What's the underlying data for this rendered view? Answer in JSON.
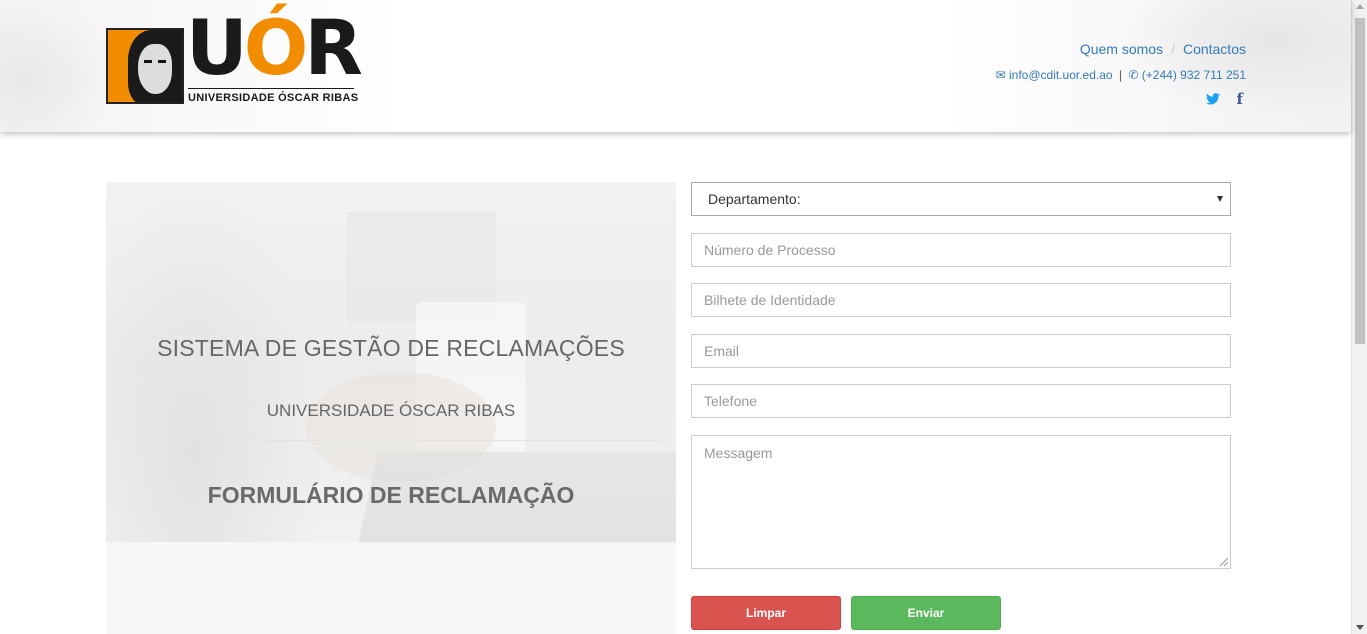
{
  "header": {
    "logo": {
      "text_dark_1": "U",
      "text_orange": "Ó",
      "text_dark_2": "R",
      "subtitle": "UNIVERSIDADE ÓSCAR RIBAS"
    },
    "nav": [
      {
        "label": "Quem somos"
      },
      {
        "label": "Contactos"
      }
    ],
    "nav_separator": "/",
    "contact": {
      "email": "info@cdit.uor.ed.ao",
      "separator": "|",
      "phone": "(+244) 932 711 251"
    },
    "social": {
      "twitter_glyph": "🐦",
      "facebook_glyph": "f"
    }
  },
  "hero": {
    "title": "SISTEMA DE GESTÃO DE RECLAMAÇÕES",
    "subtitle": "UNIVERSIDADE ÓSCAR RIBAS",
    "form_title": "FORMULÁRIO DE RECLAMAÇÃO"
  },
  "form": {
    "department_select": {
      "selected": "Departamento:"
    },
    "process_number": {
      "placeholder": "Número de Processo"
    },
    "identity_card": {
      "placeholder": "Bilhete de Identidade"
    },
    "email": {
      "placeholder": "Email"
    },
    "phone": {
      "placeholder": "Telefone"
    },
    "message": {
      "placeholder": "Messagem"
    },
    "buttons": {
      "clear": "Limpar",
      "send": "Enviar"
    }
  },
  "colors": {
    "brand_orange": "#f28c00",
    "link_blue": "#337ab7",
    "danger": "#d9534f",
    "success": "#5cb85c"
  },
  "icons": [
    "envelope-icon",
    "phone-icon",
    "twitter-icon",
    "facebook-icon",
    "select-caret-icon",
    "resize-grip-icon"
  ]
}
